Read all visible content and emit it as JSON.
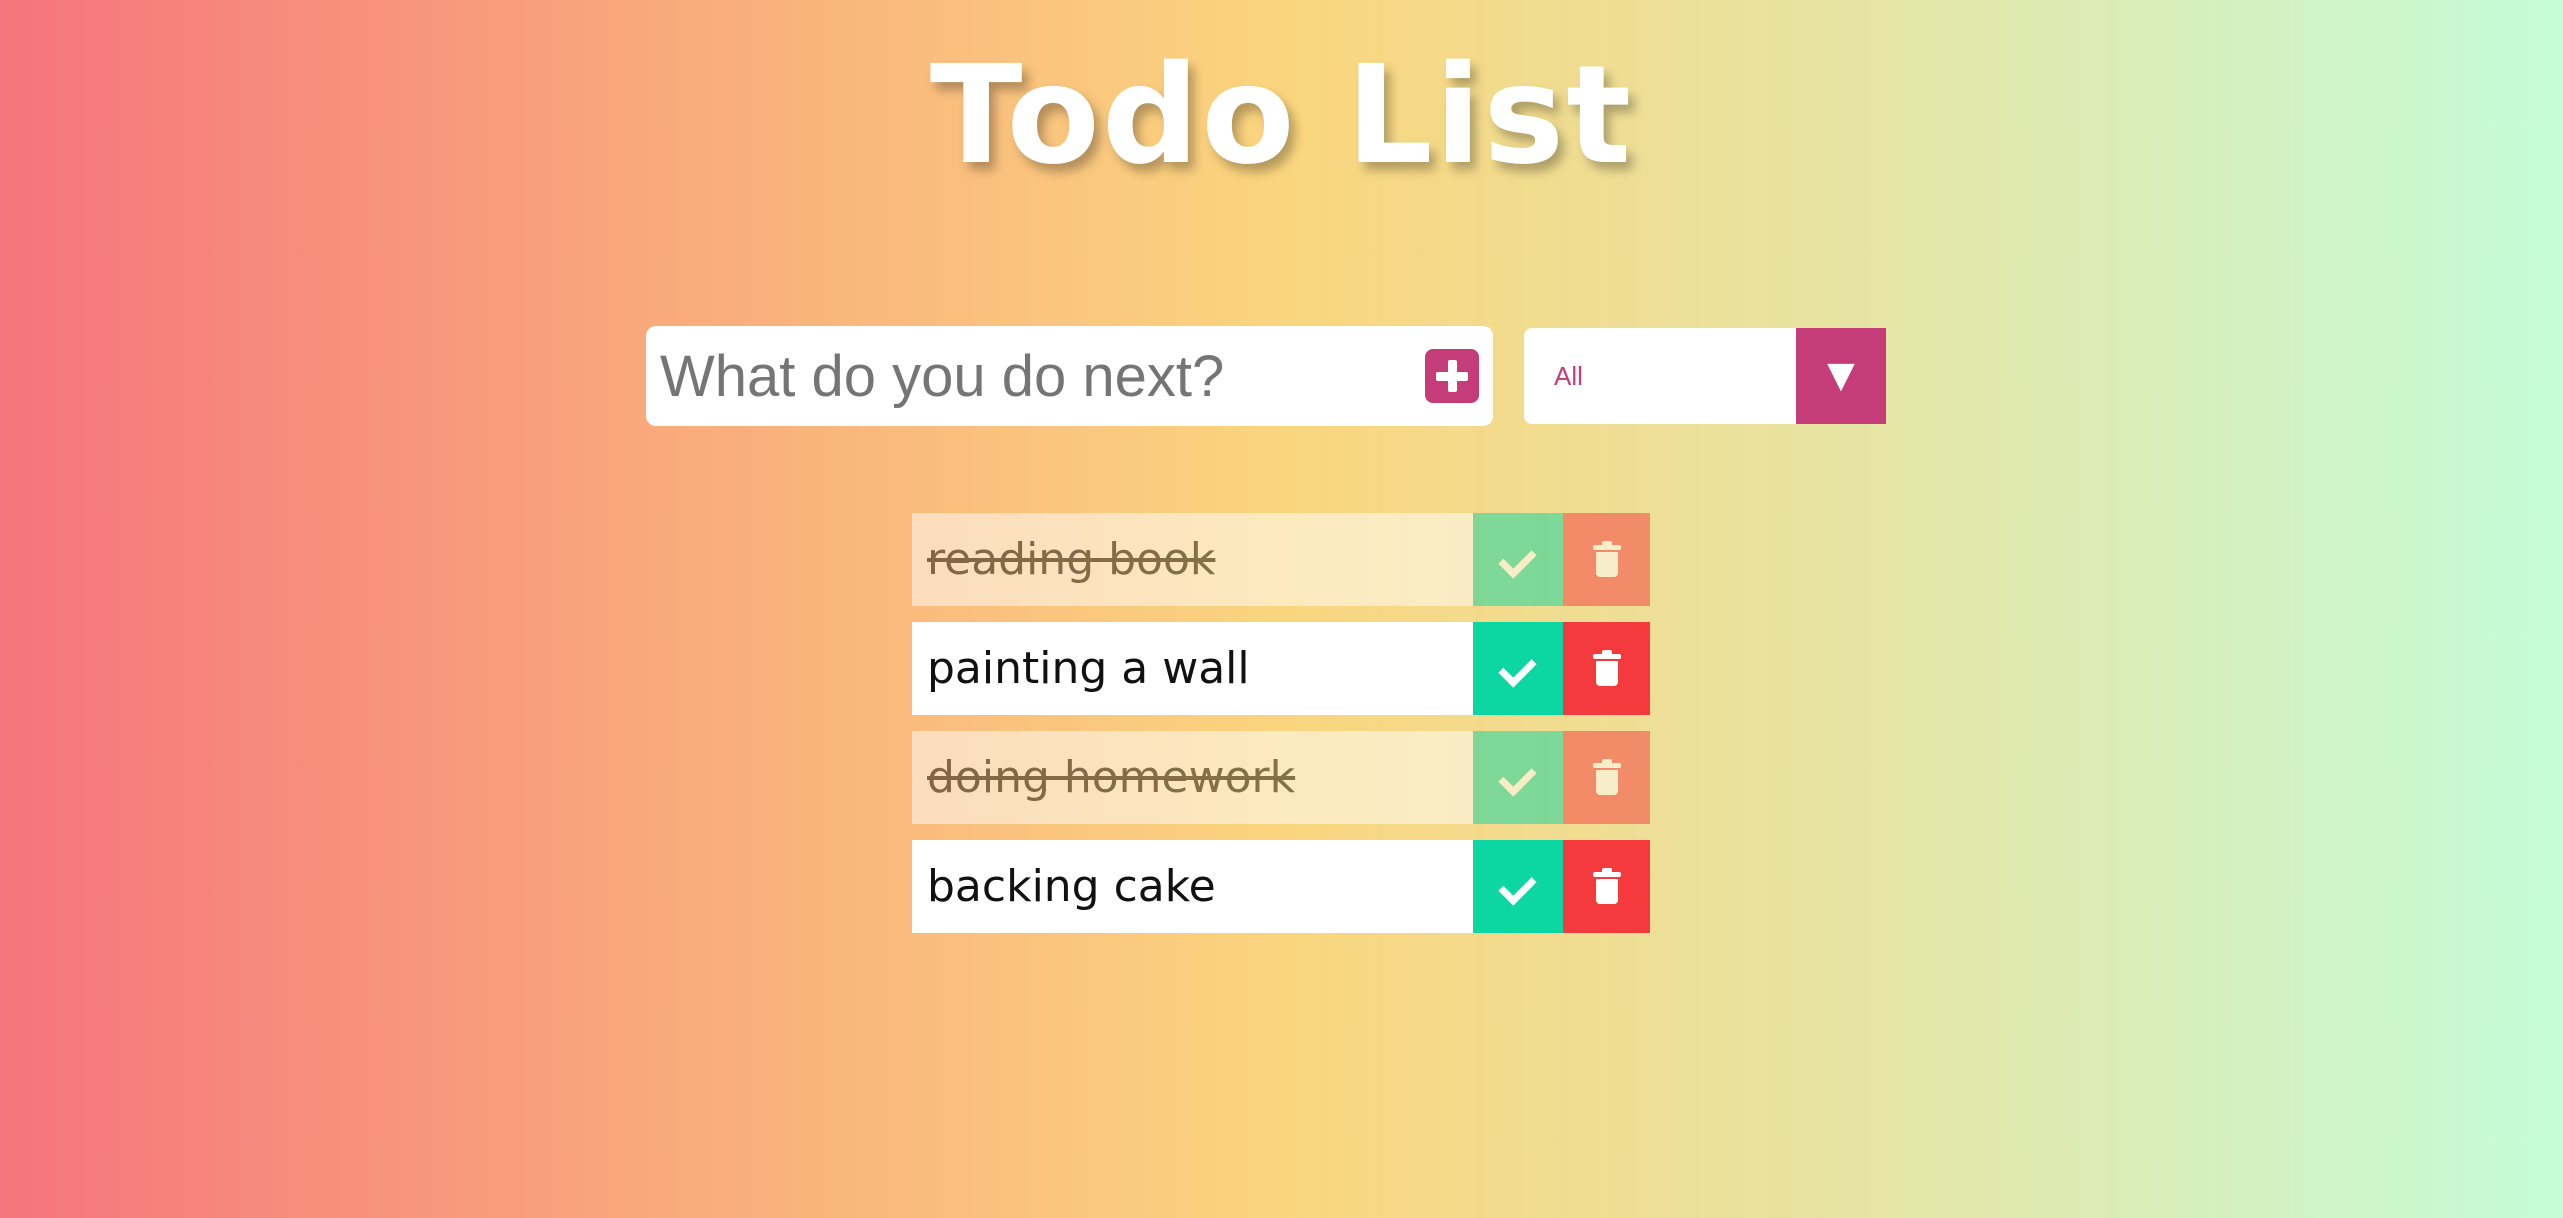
{
  "header": {
    "title": "Todo List"
  },
  "form": {
    "input_placeholder": "What do you do next?",
    "input_value": "",
    "add_icon": "plus-square-icon",
    "filter": {
      "selected": "All",
      "arrow": "▼"
    }
  },
  "todos": [
    {
      "text": "reading book",
      "completed": true
    },
    {
      "text": "painting a wall",
      "completed": false
    },
    {
      "text": "doing homework",
      "completed": true
    },
    {
      "text": "backing cake",
      "completed": false
    }
  ],
  "colors": {
    "accent": "#c43d78",
    "check": "#0cd6a2",
    "trash": "#f53a3d",
    "gradient": [
      "#f6747d",
      "#fad57e",
      "#c4fcd8"
    ]
  }
}
